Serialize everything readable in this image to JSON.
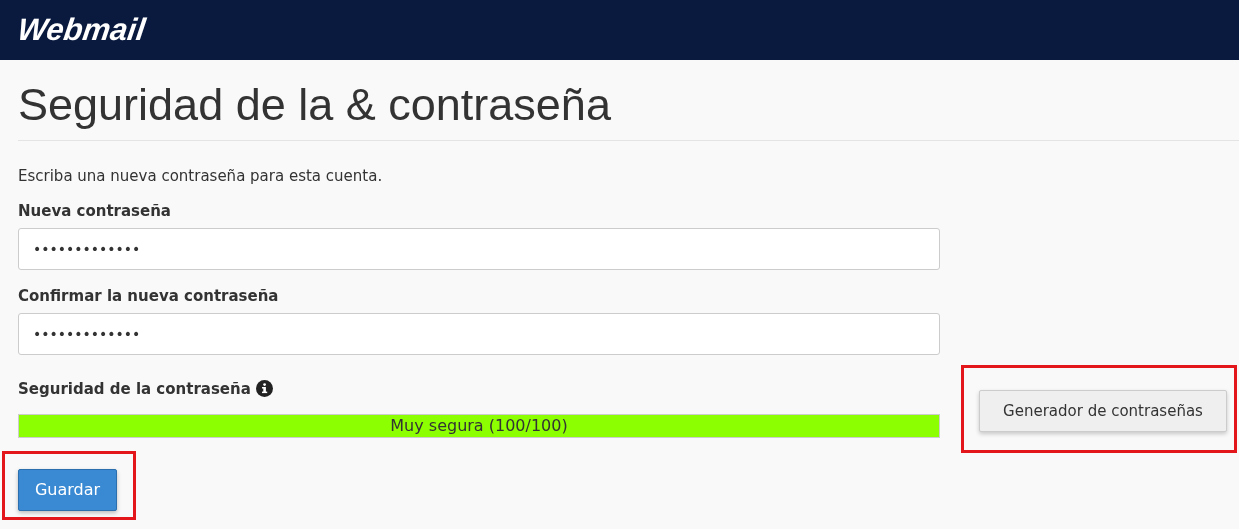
{
  "header": {
    "logo": "Webmail"
  },
  "title": "Seguridad de la & contraseña",
  "intro": "Escriba una nueva contraseña para esta cuenta.",
  "fields": [
    {
      "label": "Nueva contraseña",
      "value": "•••••••••••••"
    },
    {
      "label": "Confirmar la nueva contraseña",
      "value": "•••••••••••••"
    }
  ],
  "strength": {
    "label": "Seguridad de la contraseña",
    "level": 1,
    "reading": "Muy segura (100/100)"
  },
  "generator_button": {
    "label": "Generador de contraseñas",
    "highlighted": true
  },
  "save_button": {
    "label": "Guardar",
    "highlighted": true
  }
}
